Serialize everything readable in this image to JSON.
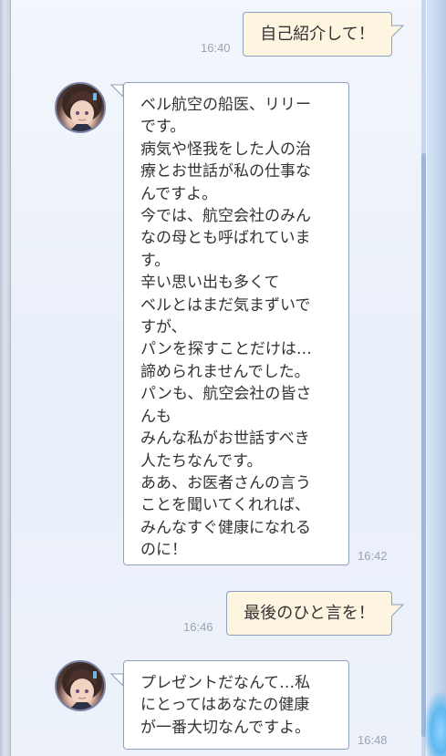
{
  "messages": [
    {
      "side": "out",
      "text": "自己紹介して！",
      "time": "16:40"
    },
    {
      "side": "in",
      "time": "16:42",
      "lines": [
        "ベル航空の船医、リリー",
        "です。",
        "病気や怪我をした人の治",
        "療とお世話が私の仕事な",
        "んですよ。",
        "今では、航空会社のみん",
        "なの母とも呼ばれていま",
        "す。",
        "辛い思い出も多くて",
        "ベルとはまだ気まずいで",
        "すが、",
        "パンを探すことだけは…",
        "諦められませんでした。",
        "パンも、航空会社の皆さ",
        "んも",
        "みんな私がお世話すべき",
        "人たちなんです。",
        "ああ、お医者さんの言う",
        "ことを聞いてくれれば、",
        "みんなすぐ健康になれる",
        "のに！"
      ]
    },
    {
      "side": "out",
      "text": "最後のひと言を！",
      "time": "16:46"
    },
    {
      "side": "in",
      "time": "16:48",
      "lines": [
        "プレゼントだなんて…私",
        "にとってはあなたの健康",
        "が一番大切なんですよ。"
      ]
    }
  ],
  "colors": {
    "out_bubble": "#fdf5e0",
    "in_bubble": "#ffffff",
    "border": "#8ea0bf",
    "timestamp": "#9aa4b2"
  }
}
